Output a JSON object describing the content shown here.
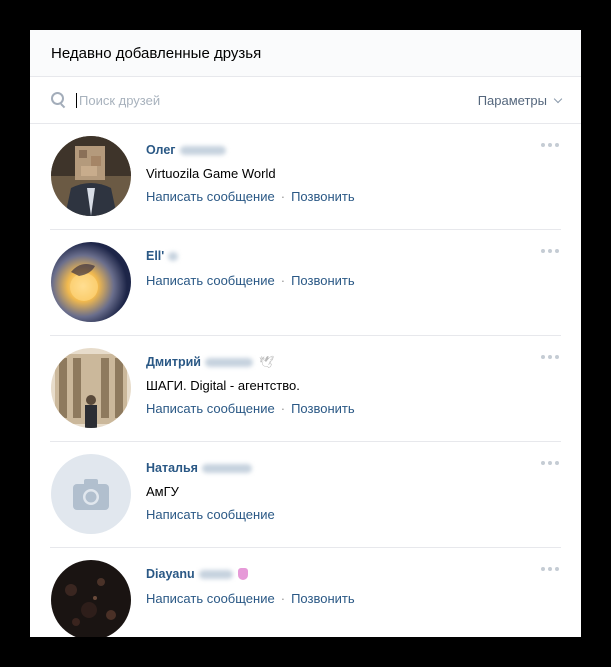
{
  "header": {
    "title": "Недавно добавленные друзья"
  },
  "search": {
    "placeholder": "Поиск друзей",
    "params_label": "Параметры"
  },
  "friends": [
    {
      "first_name": "Олег",
      "subtitle": "Virtuozila Game World",
      "write": "Написать сообщение",
      "call": "Позвонить"
    },
    {
      "first_name": "Ell'",
      "subtitle": "",
      "write": "Написать сообщение",
      "call": "Позвонить"
    },
    {
      "first_name": "Дмитрий",
      "subtitle": "ШАГИ. Digital - агентство.",
      "write": "Написать сообщение",
      "call": "Позвонить"
    },
    {
      "first_name": "Наталья",
      "subtitle": "АмГУ",
      "write": "Написать сообщение",
      "call": ""
    },
    {
      "first_name": "Diayanu",
      "subtitle": "",
      "write": "Написать сообщение",
      "call": "Позвонить"
    }
  ],
  "separator": "·",
  "colors": {
    "link": "#2a5885",
    "background": "#000000",
    "panel": "#ffffff"
  }
}
